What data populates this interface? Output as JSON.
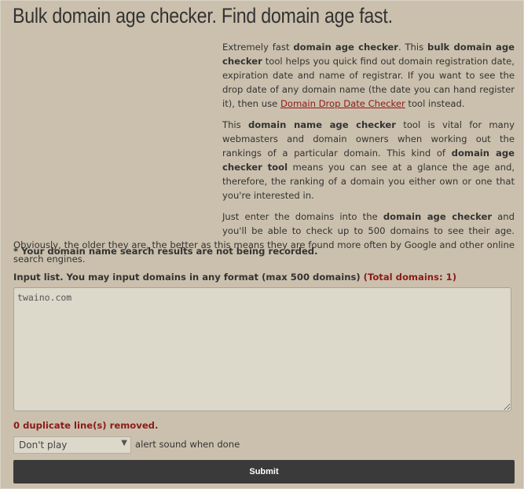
{
  "page": {
    "title": "Bulk domain age checker. Find domain age fast."
  },
  "description": {
    "p1_a": "Extremely fast ",
    "p1_b": "domain age checker",
    "p1_c": ". This ",
    "p1_d": "bulk domain age checker",
    "p1_e": " tool helps you quick find out domain registration date, expiration date and name of registrar. If you want to see the drop date of any domain name (the date you can hand register it), then use ",
    "p1_link": "Domain Drop Date Checker",
    "p1_f": " tool instead.",
    "p2_a": "This ",
    "p2_b": "domain name age checker",
    "p2_c": " tool is vital for many webmasters and domain owners when working out the rankings of a particular domain. This kind of ",
    "p2_d": "domain age checker tool",
    "p2_e": " means you can see at a glance the age and, therefore, the ranking of a domain you either own or one that you're interested in.",
    "p3_a": "Just enter the domains into the ",
    "p3_b": "domain age checker",
    "p3_c": " and you'll be able to check up to 500 domains to see their age. Obviously, the older they are, the better as this means they are found more often by Google and other online search engines."
  },
  "note": "* Your domain name search results are not being recorded.",
  "input": {
    "label": "Input list. You may input domains in any format (max 500 domains)",
    "total": "(Total domains: 1)",
    "value": "twaino.com"
  },
  "duplicates": "0 duplicate line(s) removed.",
  "sound": {
    "selected": "Don't play",
    "suffix": "alert sound when done"
  },
  "submit_label": "Submit"
}
